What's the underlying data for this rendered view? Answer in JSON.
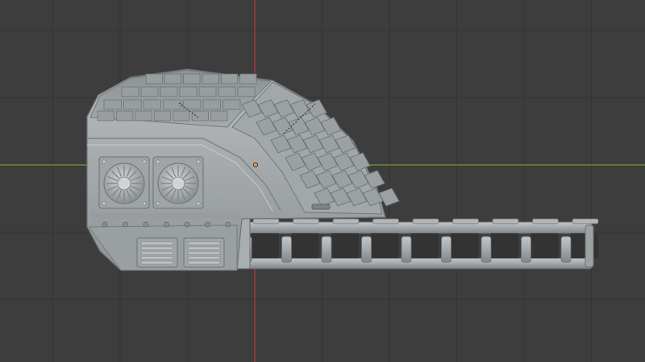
{
  "viewport": {
    "kind": "3d-viewport",
    "background": "#3d3d3d",
    "grid_color": "#353535",
    "x_axis_color": "#6f9a35",
    "y_axis_color": "#b8353e",
    "origin_marker_color": "#f09a2b"
  },
  "model": {
    "name": "",
    "material_color": "#a6abae",
    "parts": [
      {
        "name": "turret-housing"
      },
      {
        "name": "roof-plating"
      },
      {
        "name": "front-armor-panels"
      },
      {
        "name": "cooling-fan",
        "count": 2
      },
      {
        "name": "vent-grille",
        "count": 2
      },
      {
        "name": "rivet-row",
        "count": 7
      },
      {
        "name": "barrel-rail",
        "segments": 9
      }
    ]
  }
}
